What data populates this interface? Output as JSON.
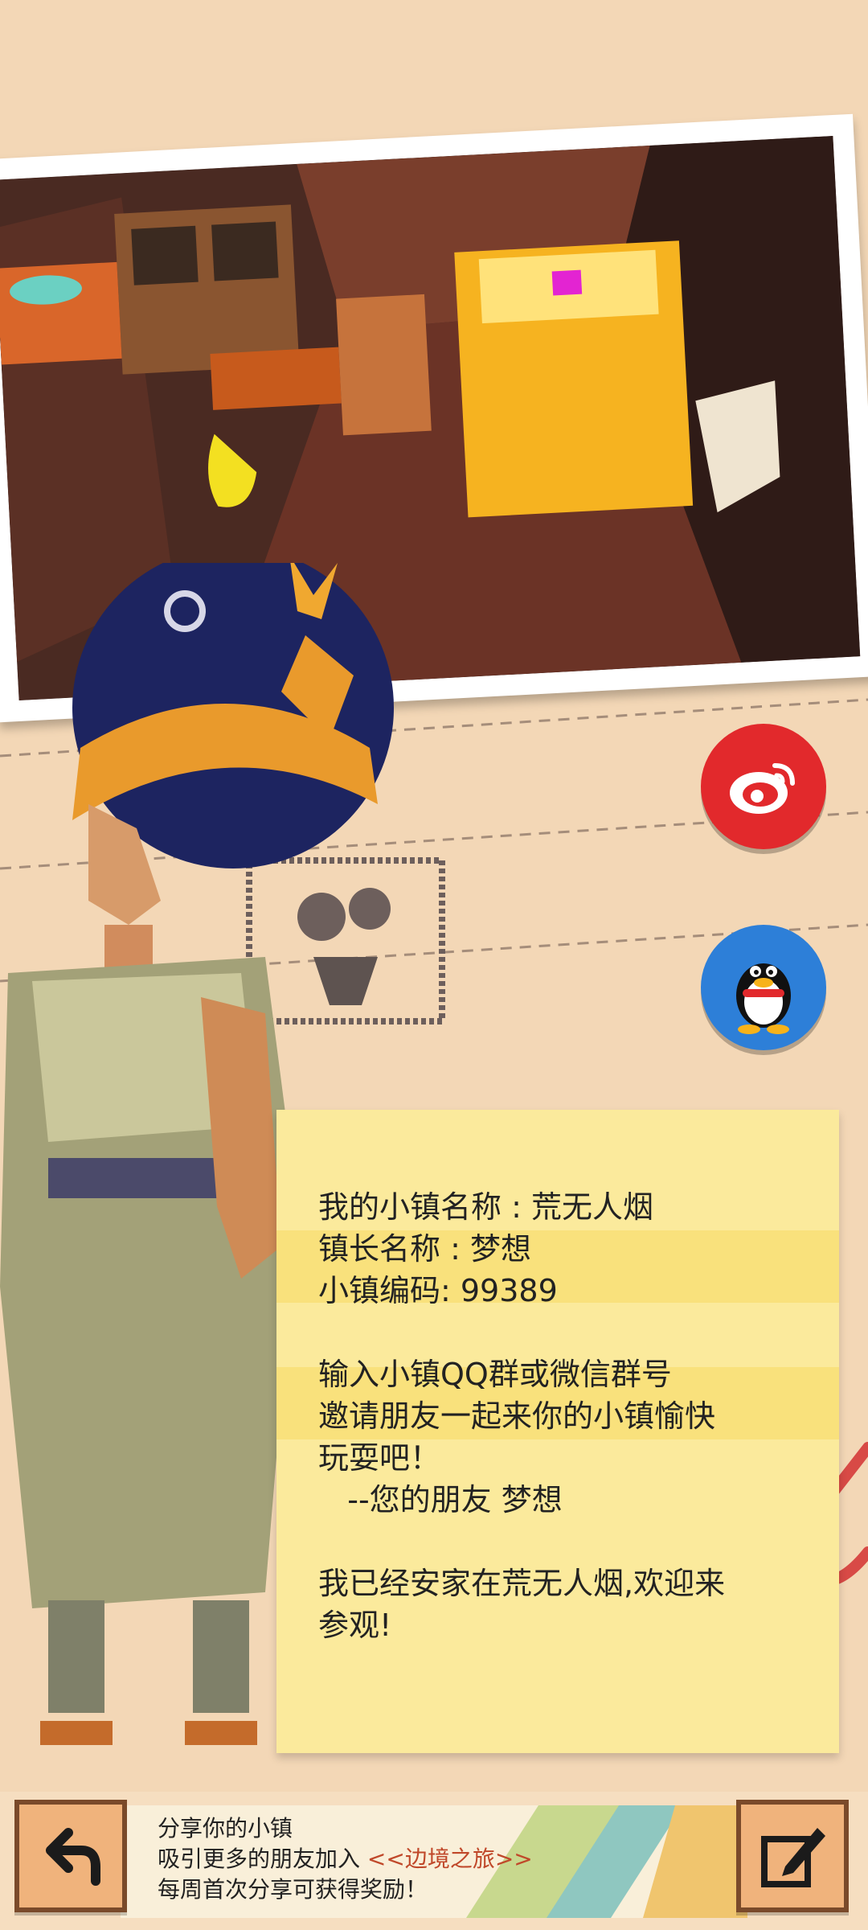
{
  "share_buttons": {
    "weibo": {
      "icon": "weibo-icon"
    },
    "qq": {
      "icon": "qq-penguin-icon"
    }
  },
  "note": {
    "lines": [
      "我的小镇名称 : 荒无人烟",
      "镇长名称 : 梦想",
      "小镇编码: 99389",
      "",
      "输入小镇QQ群或微信群号",
      "邀请朋友一起来你的小镇愉快",
      "玩耍吧！",
      "   --您的朋友 梦想",
      "",
      "我已经安家在荒无人烟,欢迎来",
      "参观!"
    ]
  },
  "bottom_bar": {
    "line1": "分享你的小镇",
    "line2_prefix": "吸引更多的朋友加入 ",
    "line2_accent": "<<边境之旅>>",
    "line3": "每周首次分享可获得奖励！",
    "back_icon": "back-arrow-icon",
    "edit_icon": "edit-pencil-icon"
  },
  "colors": {
    "paper": "#f3d7b6",
    "note": "#fbea9c",
    "weibo": "#e2292c",
    "qq": "#2d7fd8",
    "accent_text": "#c0482a"
  }
}
